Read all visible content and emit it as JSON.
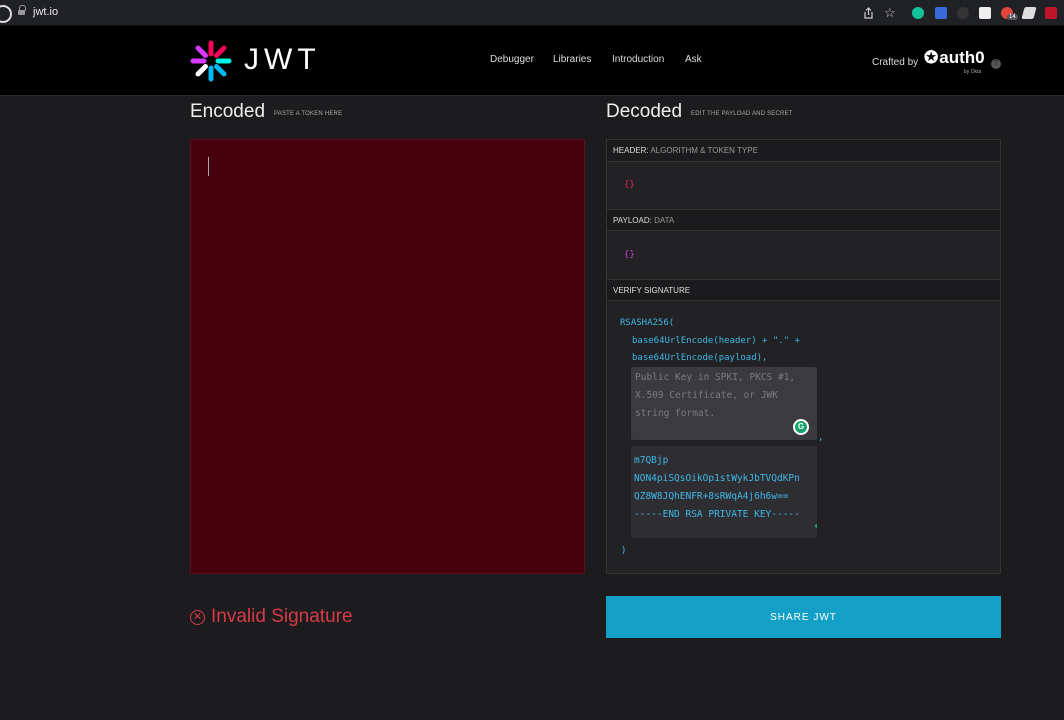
{
  "browser": {
    "url": "jwt.io",
    "extension_badge": "14"
  },
  "nav": {
    "logo_text": "JWT",
    "links": [
      "Debugger",
      "Libraries",
      "Introduction",
      "Ask"
    ],
    "crafted_by": "Crafted by",
    "brand": "auth0",
    "brand_sub": "by Okta",
    "help": "?"
  },
  "encoded": {
    "title": "Encoded",
    "subtitle": "PASTE A TOKEN HERE"
  },
  "decoded": {
    "title": "Decoded",
    "subtitle": "EDIT THE PAYLOAD AND SECRET",
    "header": {
      "label": "HEADER:",
      "hint": "ALGORITHM & TOKEN TYPE",
      "value": "{}"
    },
    "payload": {
      "label": "PAYLOAD:",
      "hint": "DATA",
      "value": "{}"
    },
    "verify": {
      "label": "VERIFY SIGNATURE",
      "line1": "RSASHA256(",
      "line2": "base64UrlEncode(header) + \".\" +",
      "line3": "base64UrlEncode(payload),",
      "public_key_placeholder": "Public Key in SPKI, PKCS #1, X.509 Certificate, or JWK string format.",
      "comma": ",",
      "private_key_lines": [
        "m7QBjp",
        "NON4piSQsOikOp1stWykJbTVQdKPn",
        "QZ8W8JQhENFR+8sRWqA4j6h6w==",
        "-----END RSA PRIVATE KEY-----"
      ],
      "close": ")"
    }
  },
  "status": {
    "text": "Invalid Signature",
    "color": "#d63a4a"
  },
  "share_button": "SHARE JWT",
  "colors": {
    "accent": "#14a0c6",
    "encoded_bg": "#47000e"
  }
}
